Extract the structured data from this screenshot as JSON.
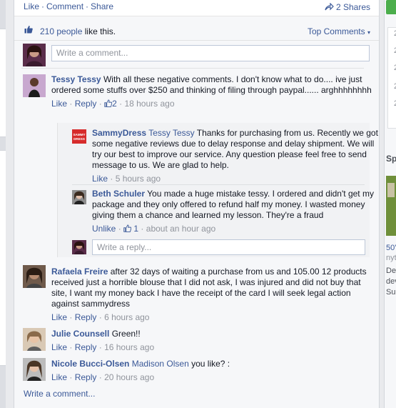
{
  "topbar": {
    "like": "Like",
    "comment": "Comment",
    "share": "Share",
    "shares": "2 Shares"
  },
  "likes": {
    "count": "210 people",
    "suffix": "like this.",
    "top_comments": "Top Comments"
  },
  "composer": {
    "placeholder": "Write a comment..."
  },
  "comments": [
    {
      "author": "Tessy Tessy",
      "text": "With all these negative comments. I don't know what to do.... ive just ordered some stuffs over $250 and thinking of filing through paypal...... arghhhhhhhh",
      "like": "Like",
      "reply": "Reply",
      "likes": "2",
      "time": "18 hours ago"
    },
    {
      "author": "Rafaela Freire",
      "text": "after 32 days of waiting a purchase from us and 105.00 12 products received just a horrible blouse that I did not ask, I was injured and did not buy that site, I want my money back I have the receipt of the card I will seek legal action against sammydress",
      "like": "Like",
      "reply": "Reply",
      "time": "6 hours ago"
    },
    {
      "author": "Julie Counsell",
      "text": "Green!!",
      "like": "Like",
      "reply": "Reply",
      "time": "16 hours ago"
    },
    {
      "author": "Nicole Bucci-Olsen",
      "mention": "Madison Olsen",
      "text": "you like? :",
      "like": "Like",
      "reply": "Reply",
      "time": "20 hours ago"
    }
  ],
  "replies": [
    {
      "author": "SammyDress",
      "mention": "Tessy Tessy",
      "text": "Thanks for purchasing from us. Recently we got some negative reviews due to delay response and delay shipment. We will try our best to improve our service. Any question please feel free to send message to us. We are glad to help.",
      "like": "Like",
      "time": "5 hours ago",
      "logo": "SAMMY DRESS"
    },
    {
      "author": "Beth Schuler",
      "text": "You made a huge mistake tessy. I ordered and didn't get my package and they only offered to refund half my money. I wasted money giving them a chance and learned my lesson. They're a fraud",
      "unlike": "Unlike",
      "likes": "1",
      "time": "about an hour ago"
    }
  ],
  "reply_composer": {
    "placeholder": "Write a reply..."
  },
  "footer": {
    "write_comment": "Write a comment..."
  },
  "right_panel": {
    "sp": "Sp",
    "nums": [
      "2",
      "2",
      "2",
      "2",
      "2"
    ],
    "link": "50'",
    "site": "nyt",
    "lines": [
      "De",
      "dev",
      "Su"
    ]
  },
  "colors": {
    "link": "#3b5998",
    "background": "#e9eaed",
    "card": "#f6f7f9",
    "green": "#4cae4c"
  }
}
